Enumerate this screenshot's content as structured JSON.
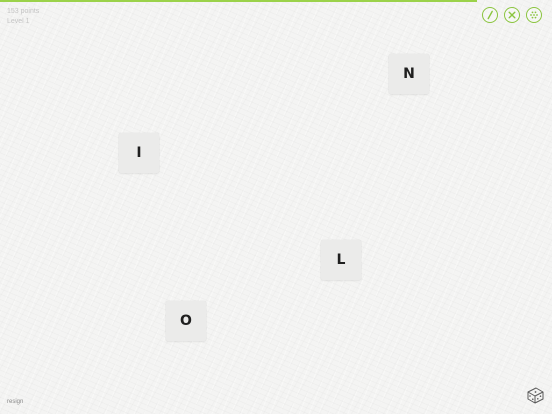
{
  "progress": {
    "fraction": 0.864,
    "color": "#9bd24a"
  },
  "stats": {
    "score": "153 points",
    "level": "Level 1"
  },
  "controls": {
    "accent_color": "#8bc53f",
    "buttons": [
      {
        "name": "submit",
        "icon": "check-icon"
      },
      {
        "name": "clear",
        "icon": "close-icon"
      },
      {
        "name": "shuffle",
        "icon": "shuffle-dots-icon"
      }
    ]
  },
  "tiles": [
    {
      "letter": "N"
    },
    {
      "letter": "I"
    },
    {
      "letter": "L"
    },
    {
      "letter": "O"
    }
  ],
  "footer": {
    "resign": "resign",
    "dice_icon": "dice-icon"
  }
}
